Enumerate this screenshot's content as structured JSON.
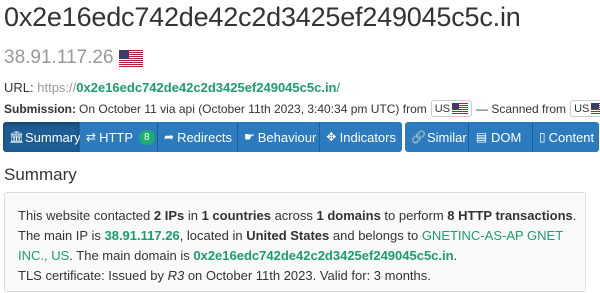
{
  "page": {
    "title": "0x2e16edc742de42c2d3425ef249045c5c.in",
    "ip": "38.91.117.26",
    "flag_icon": "us-flag-icon"
  },
  "url_line": {
    "label": "URL:",
    "scheme": "https://",
    "domain": "0x2e16edc742de42c2d3425ef249045c5c.in",
    "suffix": "/"
  },
  "submission": {
    "label": "Submission:",
    "text": "On October 11 via api (October 11th 2023, 3:40:34 pm UTC) from",
    "from_country": "US",
    "scanned_label": "— Scanned from",
    "scanned_country": "US"
  },
  "tabs": {
    "group1": [
      {
        "key": "summary",
        "label": "Summary",
        "icon": "bank-icon",
        "active": true
      },
      {
        "key": "http",
        "label": "HTTP",
        "icon": "exchange-icon",
        "badge": "8"
      },
      {
        "key": "redirects",
        "label": "Redirects",
        "icon": "share-arrow-icon"
      },
      {
        "key": "behaviour",
        "label": "Behaviour",
        "icon": "pointer-icon"
      },
      {
        "key": "indicators",
        "label": "Indicators",
        "icon": "crosshair-icon"
      }
    ],
    "group2": [
      {
        "key": "similar",
        "label": "Similar",
        "icon": "link-icon"
      },
      {
        "key": "dom",
        "label": "DOM",
        "icon": "document-icon"
      },
      {
        "key": "content",
        "label": "Content",
        "icon": "file-icon"
      }
    ]
  },
  "summary": {
    "heading": "Summary",
    "s1": "This website contacted",
    "ips": "2 IPs",
    "s2": "in",
    "countries": "1 countries",
    "s3": "across",
    "domains": "1 domains",
    "s4": "to perform",
    "transactions": "8 HTTP transactions",
    "s5": ".",
    "s6": "The main IP is",
    "main_ip": "38.91.117.26",
    "s7": ", located in",
    "country": "United States",
    "s8": "and belongs to",
    "asn": "GNETINC-AS-AP GNET INC., US",
    "s9": ". The main domain is",
    "main_domain": "0x2e16edc742de42c2d3425ef249045c5c.in",
    "s10": ".",
    "tls_prefix": "TLS certificate: Issued by",
    "issuer": "R3",
    "tls_suffix": "on October 11th 2023. Valid for: 3 months."
  }
}
